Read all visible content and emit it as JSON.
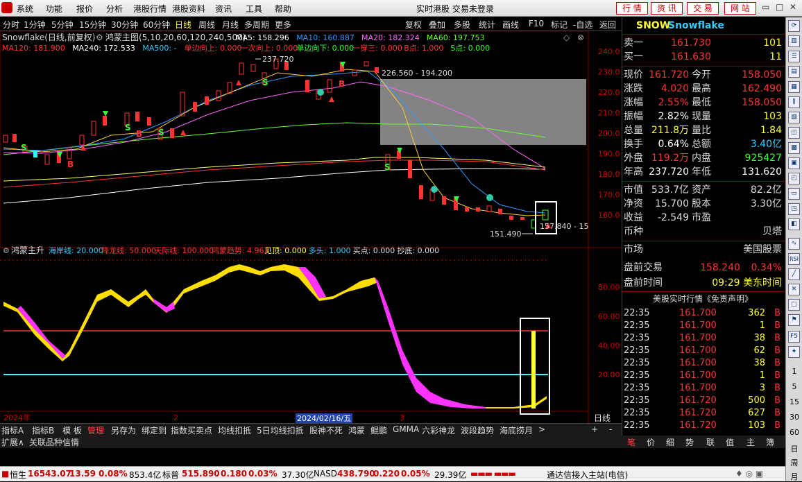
{
  "menu": {
    "items": [
      "系统",
      "功能",
      "报价",
      "分析",
      "港股行情",
      "港股资料",
      "资讯",
      "工具",
      "帮助"
    ],
    "title": "实时港股 交易未登录",
    "buttons": [
      "行 情",
      "资 讯",
      "交 易",
      "网 站"
    ]
  },
  "toolbar": {
    "periods": [
      "分时",
      "1分钟",
      "5分钟",
      "15分钟",
      "30分钟",
      "60分钟",
      "日线",
      "周线",
      "月线",
      "多周期",
      "更多"
    ],
    "active_period": "日线",
    "right_buttons": [
      "复权",
      "叠加",
      "多股",
      "统计",
      "画线",
      "F10",
      "标记",
      "-自选",
      "返回"
    ]
  },
  "main_chart": {
    "title": "Snowflake(日线,前复权)",
    "indicator": "鸿蒙主图(5,10,20,60,120,240,500)",
    "ma_row1": [
      {
        "label": "MA5: 158.296",
        "color": "#ffffff"
      },
      {
        "label": "MA10: 160.887",
        "color": "#3399ff"
      },
      {
        "label": "MA20: 182.324",
        "color": "#ff66ff"
      },
      {
        "label": "MA60: 197.753",
        "color": "#66ff33"
      }
    ],
    "ma_row2": [
      {
        "label": "MA120: 181.900",
        "color": "#ff3333"
      },
      {
        "label": "MA240: 172.533",
        "color": "#ffffff"
      },
      {
        "label": "MA500: -",
        "color": "#33ccff"
      },
      {
        "label": "单边向上: 0.000",
        "color": "#ff3333"
      },
      {
        "label": "一次向上: 0.000",
        "color": "#ff3333"
      },
      {
        "label": "单边向下: 0.000",
        "color": "#33ff33"
      },
      {
        "label": "一穿三: 0.000",
        "color": "#ff3333"
      },
      {
        "label": "B点: 1.000",
        "color": "#ff3333"
      },
      {
        "label": "S点: 0.000",
        "color": "#33ff33"
      }
    ],
    "y_labels": [
      "240.0",
      "230.0",
      "220.0",
      "210.0",
      "200.0",
      "190.0",
      "180.0",
      "170.0",
      "160.0"
    ],
    "annot_high": "237.720",
    "annot_range": "226.560 - 194.200",
    "annot_low": "151.490",
    "annot_last": "157.840 - 15"
  },
  "sub_chart": {
    "title": "鸿蒙主升",
    "params": [
      {
        "label": "海岸线: 20.000",
        "color": "#33ccff"
      },
      {
        "label": "降龙线: 50.000",
        "color": "#ff3333"
      },
      {
        "label": "天际线: 100.000",
        "color": "#ff3333"
      },
      {
        "label": "鸿蒙趋势: 4.963",
        "color": "#ff3333"
      },
      {
        "label": "见顶: 0.000",
        "color": "#ffff33"
      },
      {
        "label": "多头: 1.000",
        "color": "#33ccff"
      },
      {
        "label": "买点: 0.000",
        "color": "#dddddd"
      },
      {
        "label": "抄底: 0.000",
        "color": "#dddddd"
      }
    ],
    "y_labels": [
      "80.00",
      "60.00",
      "40.00",
      "20.00"
    ]
  },
  "x_axis": {
    "labels": [
      "2024年",
      "2",
      "3",
      "2024/02/16/五",
      "3"
    ],
    "period_label": "日线"
  },
  "indicator_tabs": [
    "指标A",
    "指标B",
    "模 板",
    "管理",
    "另存为",
    "绑定到",
    "指数买卖点",
    "均线扣抵",
    "5日均线扣抵",
    "股神不死",
    "鸿蒙",
    "鲲鹏",
    "GMMA",
    "六彩神龙",
    "波段趋势",
    "海底捞月"
  ],
  "active_tab": "管理",
  "tab_extras": [
    ">",
    "+",
    "-"
  ],
  "bottom_left": [
    "扩展∧",
    "关联品种信情"
  ],
  "quote": {
    "symbol": "SNOW",
    "name": "Snowflake",
    "sell1": {
      "label": "卖一",
      "price": "161.730",
      "vol": "101"
    },
    "buy1": {
      "label": "买一",
      "price": "161.630",
      "vol": "11"
    },
    "rows": [
      {
        "l1": "现价",
        "v1": "161.720",
        "c1": "#ff3333",
        "l2": "今开",
        "v2": "158.050",
        "c2": "#ff3333"
      },
      {
        "l1": "涨跌",
        "v1": "4.020",
        "c1": "#ff3333",
        "l2": "最高",
        "v2": "162.490",
        "c2": "#ff3333"
      },
      {
        "l1": "涨幅",
        "v1": "2.55%",
        "c1": "#ff3333",
        "l2": "最低",
        "v2": "158.050",
        "c2": "#ff3333"
      },
      {
        "l1": "振幅",
        "v1": "2.82%",
        "c1": "#ffffff",
        "l2": "现量",
        "v2": "103",
        "c2": "#ffff33"
      },
      {
        "l1": "总量",
        "v1": "211.8万",
        "c1": "#ffff33",
        "l2": "量比",
        "v2": "1.84",
        "c2": "#ffff33"
      },
      {
        "l1": "换手",
        "v1": "0.64%",
        "c1": "#ffffff",
        "l2": "总额",
        "v2": "3.40亿",
        "c2": "#33ccff"
      },
      {
        "l1": "外盘",
        "v1": "119.2万",
        "c1": "#ff3333",
        "l2": "内盘",
        "v2": "925427",
        "c2": "#33ff33"
      },
      {
        "l1": "年高",
        "v1": "237.720",
        "c1": "#ffffff",
        "l2": "年低",
        "v2": "131.620",
        "c2": "#ffffff"
      }
    ],
    "rows2": [
      {
        "l1": "市值",
        "v1": "533.7亿",
        "l2": "资产",
        "v2": "82.2亿"
      },
      {
        "l1": "净资",
        "v1": "15.700",
        "l2": "股本",
        "v2": "3.30亿"
      },
      {
        "l1": "收益",
        "v1": "-2.549",
        "l2": "市盈",
        "v2": ""
      },
      {
        "l1": "币种",
        "v1": "",
        "l2": "",
        "v2": "贝塔"
      }
    ],
    "market_label": "市场",
    "market_value": "美国股票",
    "premarket_label": "盘前交易",
    "premarket_price": "158.240",
    "premarket_pct": "0.34%",
    "pretime_label": "盘前时间",
    "pretime_value": "09:29 美东时间",
    "ticks_title": "美股实时行情《免责声明》",
    "ticks": [
      {
        "t": "22:35",
        "p": "161.700",
        "v": "362",
        "s": "B"
      },
      {
        "t": "22:35",
        "p": "161.700",
        "v": "1",
        "s": "B"
      },
      {
        "t": "22:35",
        "p": "161.700",
        "v": "38",
        "s": "B"
      },
      {
        "t": "22:35",
        "p": "161.700",
        "v": "62",
        "s": "B"
      },
      {
        "t": "22:35",
        "p": "161.700",
        "v": "38",
        "s": "B"
      },
      {
        "t": "22:35",
        "p": "161.700",
        "v": "1",
        "s": "B"
      },
      {
        "t": "22:35",
        "p": "161.700",
        "v": "3",
        "s": "B"
      },
      {
        "t": "22:35",
        "p": "161.720",
        "v": "500",
        "s": "B"
      },
      {
        "t": "22:35",
        "p": "161.720",
        "v": "627",
        "s": "B"
      },
      {
        "t": "22:35",
        "p": "161.720",
        "v": "103",
        "s": "B"
      }
    ],
    "tabs": [
      "笔",
      "价",
      "细",
      "势",
      "联",
      "值",
      "主",
      "簿"
    ],
    "active_tab": "笔"
  },
  "right_sidebar": {
    "icons": [
      "RSI"
    ],
    "nums": [
      "1",
      "5",
      "15",
      "30",
      "60",
      "日",
      "周",
      "月"
    ]
  },
  "bottom": {
    "hs_label": "恒生",
    "hs_val": "16543.07",
    "hs_chg": "13.59",
    "hs_pct": "0.08%",
    "hs_amt": "853.4亿",
    "sp_label": "标普",
    "sp_val": "515.890",
    "sp_chg": "0.180",
    "sp_pct": "0.03%",
    "sp_amt": "37.30亿",
    "nq_label": "NASD",
    "nq_val": "438.790",
    "nq_chg": "0.220",
    "nq_pct": "0.05%",
    "nq_amt": "29.39亿",
    "status": "通达信接入主站(电信)"
  },
  "colors": {
    "up": "#ff3333",
    "down": "#33ffff",
    "ma5": "#ffffff",
    "ma10": "#3399ff",
    "ma20": "#ff66ff",
    "ma60": "#66ff33",
    "ma120": "#ff3333",
    "ma240": "#ffff66",
    "ma500": "#33ffcc"
  }
}
